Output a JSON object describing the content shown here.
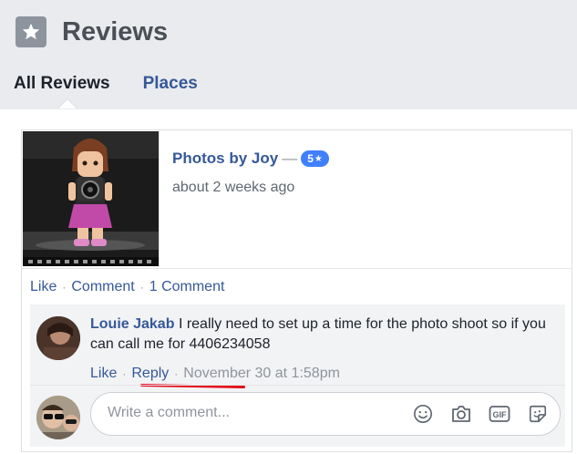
{
  "page": {
    "title": "Reviews",
    "tabs": [
      {
        "label": "All Reviews",
        "active": true
      },
      {
        "label": "Places",
        "active": false
      }
    ]
  },
  "review": {
    "author": "Photos by Joy",
    "dash": "—",
    "rating": "5",
    "rating_star": "★",
    "time": "about 2 weeks ago",
    "actions": {
      "like": "Like",
      "comment": "Comment",
      "comment_count": "1 Comment"
    }
  },
  "comment": {
    "name": "Louie Jakab",
    "text": "I really need to set up a time for the photo shoot so if you can call me for 4406234058",
    "like": "Like",
    "reply": "Reply",
    "date": "November 30 at 1:58pm"
  },
  "composer": {
    "placeholder": "Write a comment...",
    "icons": [
      "emoji-icon",
      "camera-icon",
      "gif-icon",
      "sticker-icon"
    ],
    "gif_label": "GIF"
  },
  "colors": {
    "link": "#365899",
    "badge": "#4080ff",
    "annotation": "#e4061b"
  }
}
